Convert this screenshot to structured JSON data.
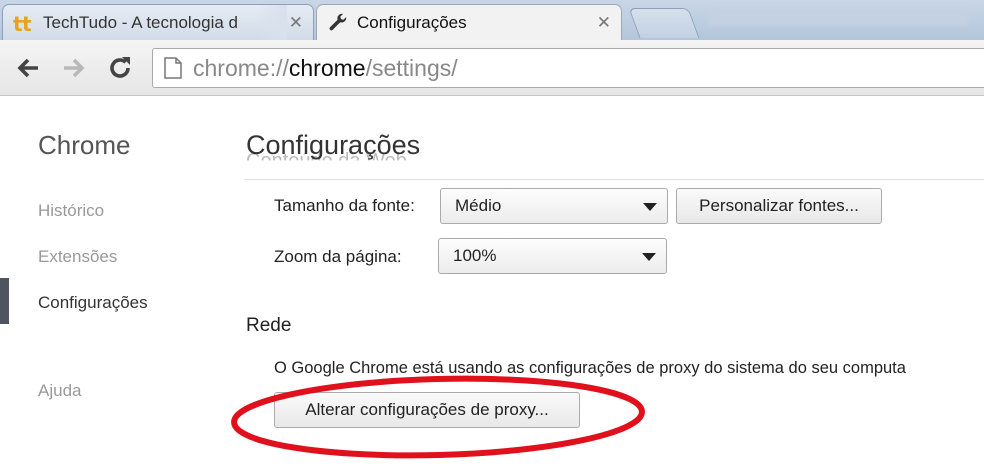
{
  "tabs": [
    {
      "title": "TechTudo - A tecnologia d",
      "active": false,
      "favicon": "techtudo-icon"
    },
    {
      "title": "Configurações",
      "active": true,
      "favicon": "wrench-icon"
    }
  ],
  "toolbar": {
    "url_scheme": "chrome://",
    "url_host": "chrome",
    "url_path": "/settings/"
  },
  "sidebar": {
    "title": "Chrome",
    "items": [
      {
        "label": "Histórico",
        "selected": false
      },
      {
        "label": "Extensões",
        "selected": false
      },
      {
        "label": "Configurações",
        "selected": true
      },
      {
        "label": "Ajuda",
        "selected": false
      }
    ]
  },
  "main": {
    "title": "Configurações",
    "font_size_label": "Tamanho da fonte:",
    "font_size_value": "Médio",
    "customize_fonts_button": "Personalizar fontes...",
    "zoom_label": "Zoom da página:",
    "zoom_value": "100%",
    "network_title": "Rede",
    "network_desc": "O Google Chrome está usando as configurações de proxy do sistema do seu computa",
    "proxy_button": "Alterar configurações de proxy..."
  },
  "colors": {
    "highlight": "#e0101c",
    "tab_strip": "#b3c6dc",
    "sidebar_marker": "#4e5560"
  }
}
